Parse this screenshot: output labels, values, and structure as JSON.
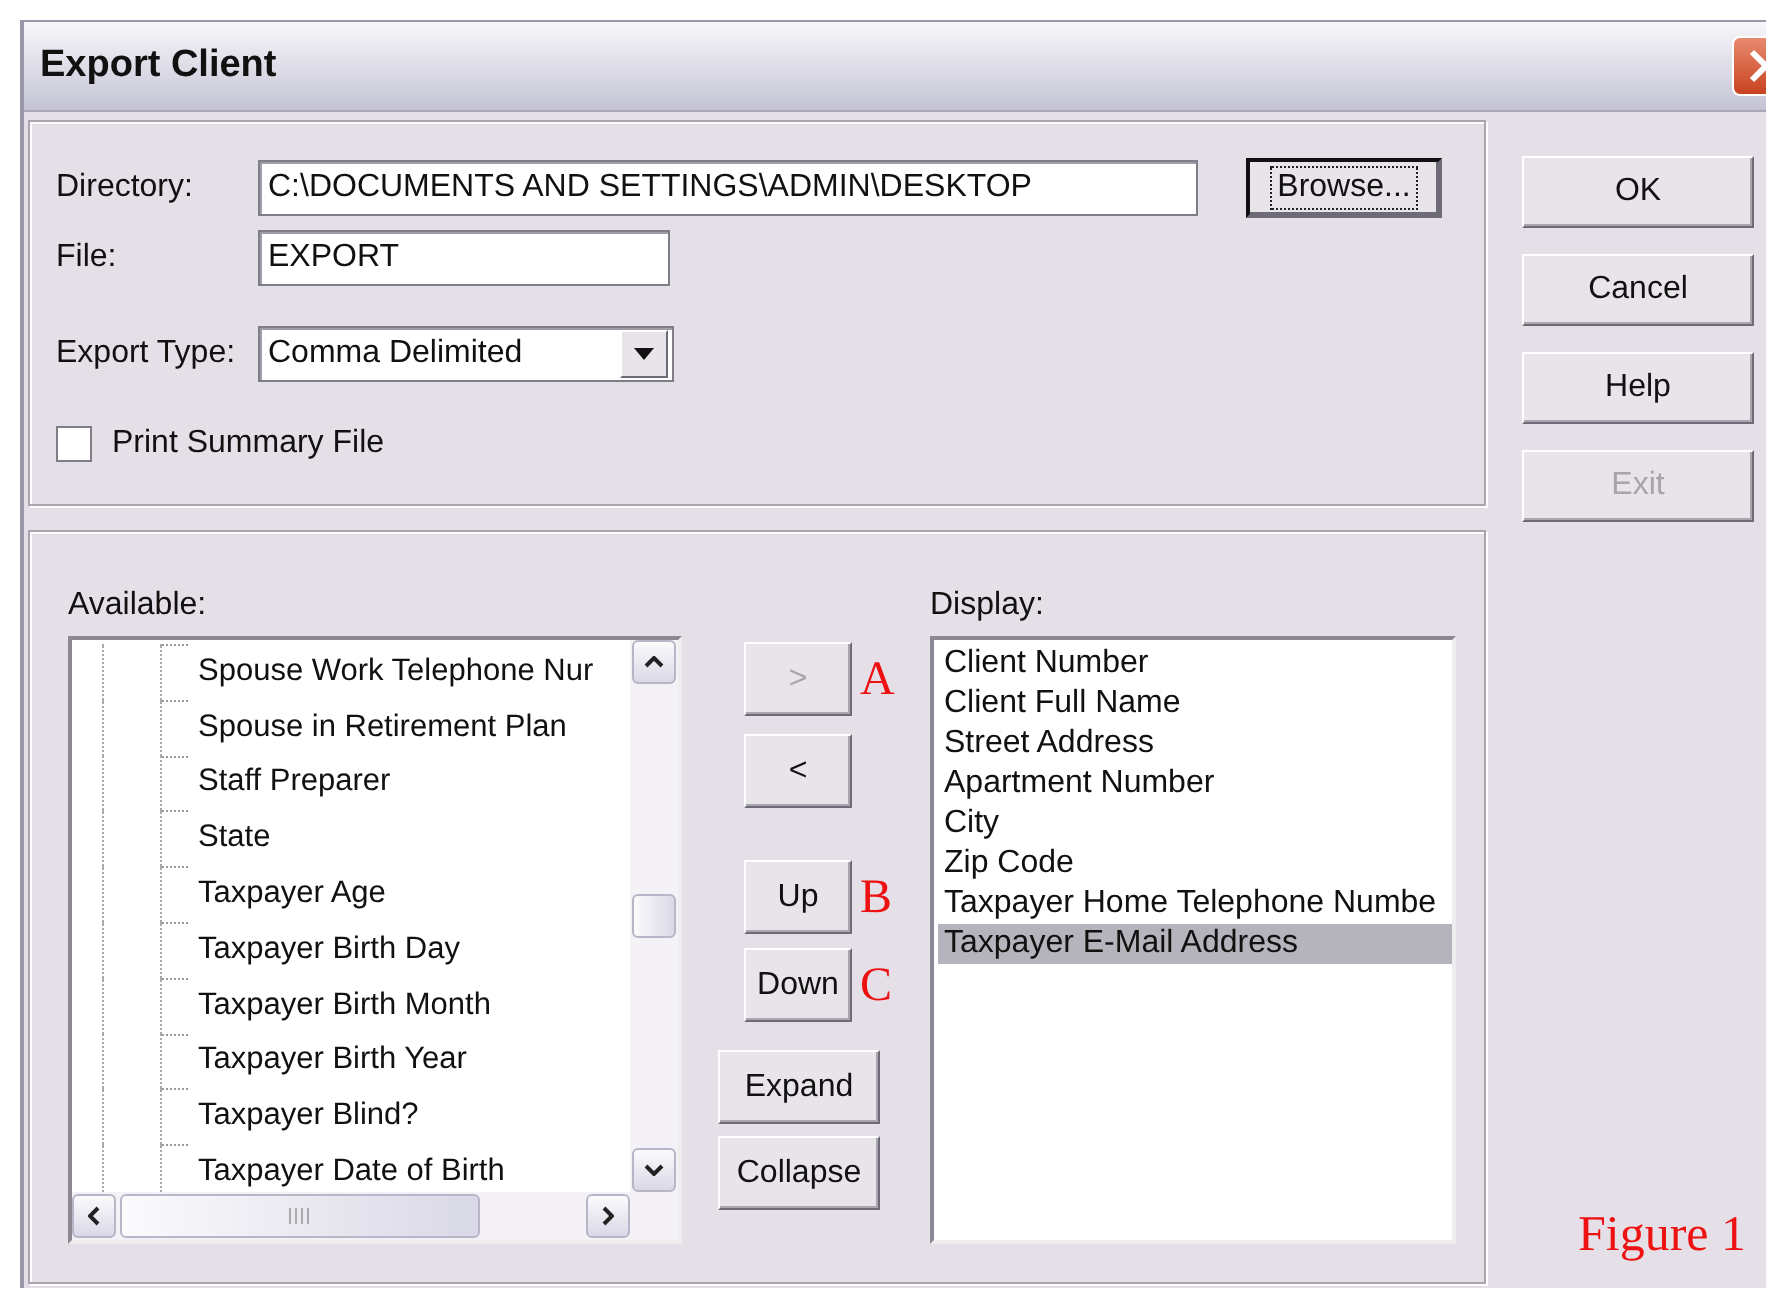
{
  "window": {
    "title": "Export Client"
  },
  "form": {
    "directory": {
      "label": "Directory:",
      "value": "C:\\DOCUMENTS AND SETTINGS\\ADMIN\\DESKTOP"
    },
    "browse_button": {
      "label": "Browse...",
      "focused": true
    },
    "file": {
      "label": "File:",
      "value": "EXPORT"
    },
    "export_type": {
      "label": "Export Type:",
      "value": "Comma Delimited"
    },
    "print_summary": {
      "label": "Print Summary File",
      "checked": false
    }
  },
  "side_buttons": [
    {
      "label": "OK",
      "disabled": false
    },
    {
      "label": "Cancel",
      "disabled": false
    },
    {
      "label": "Help",
      "disabled": false
    },
    {
      "label": "Exit",
      "disabled": true
    }
  ],
  "available": {
    "label": "Available:",
    "items": [
      "Spouse Work Telephone Nur",
      "Spouse in Retirement Plan",
      "Staff Preparer",
      "State",
      "Taxpayer Age",
      "Taxpayer Birth Day",
      "Taxpayer Birth Month",
      "Taxpayer Birth Year",
      "Taxpayer Blind?",
      "Taxpayer Date of Birth"
    ]
  },
  "move_buttons": [
    {
      "label": ">",
      "disabled": true,
      "annotation": "A"
    },
    {
      "label": "<",
      "disabled": false
    },
    {
      "label": "Up",
      "disabled": false,
      "annotation": "B"
    },
    {
      "label": "Down",
      "disabled": false,
      "annotation": "C"
    }
  ],
  "tree_buttons": [
    "Expand",
    "Collapse"
  ],
  "display": {
    "label": "Display:",
    "items": [
      {
        "label": "Client Number",
        "selected": false
      },
      {
        "label": "Client Full Name",
        "selected": false
      },
      {
        "label": "Street Address",
        "selected": false
      },
      {
        "label": "Apartment Number",
        "selected": false
      },
      {
        "label": "City",
        "selected": false
      },
      {
        "label": "Zip Code",
        "selected": false
      },
      {
        "label": "Taxpayer Home Telephone Numbe",
        "selected": false
      },
      {
        "label": "Taxpayer E-Mail Address",
        "selected": true
      }
    ]
  },
  "caption": "Figure 1"
}
